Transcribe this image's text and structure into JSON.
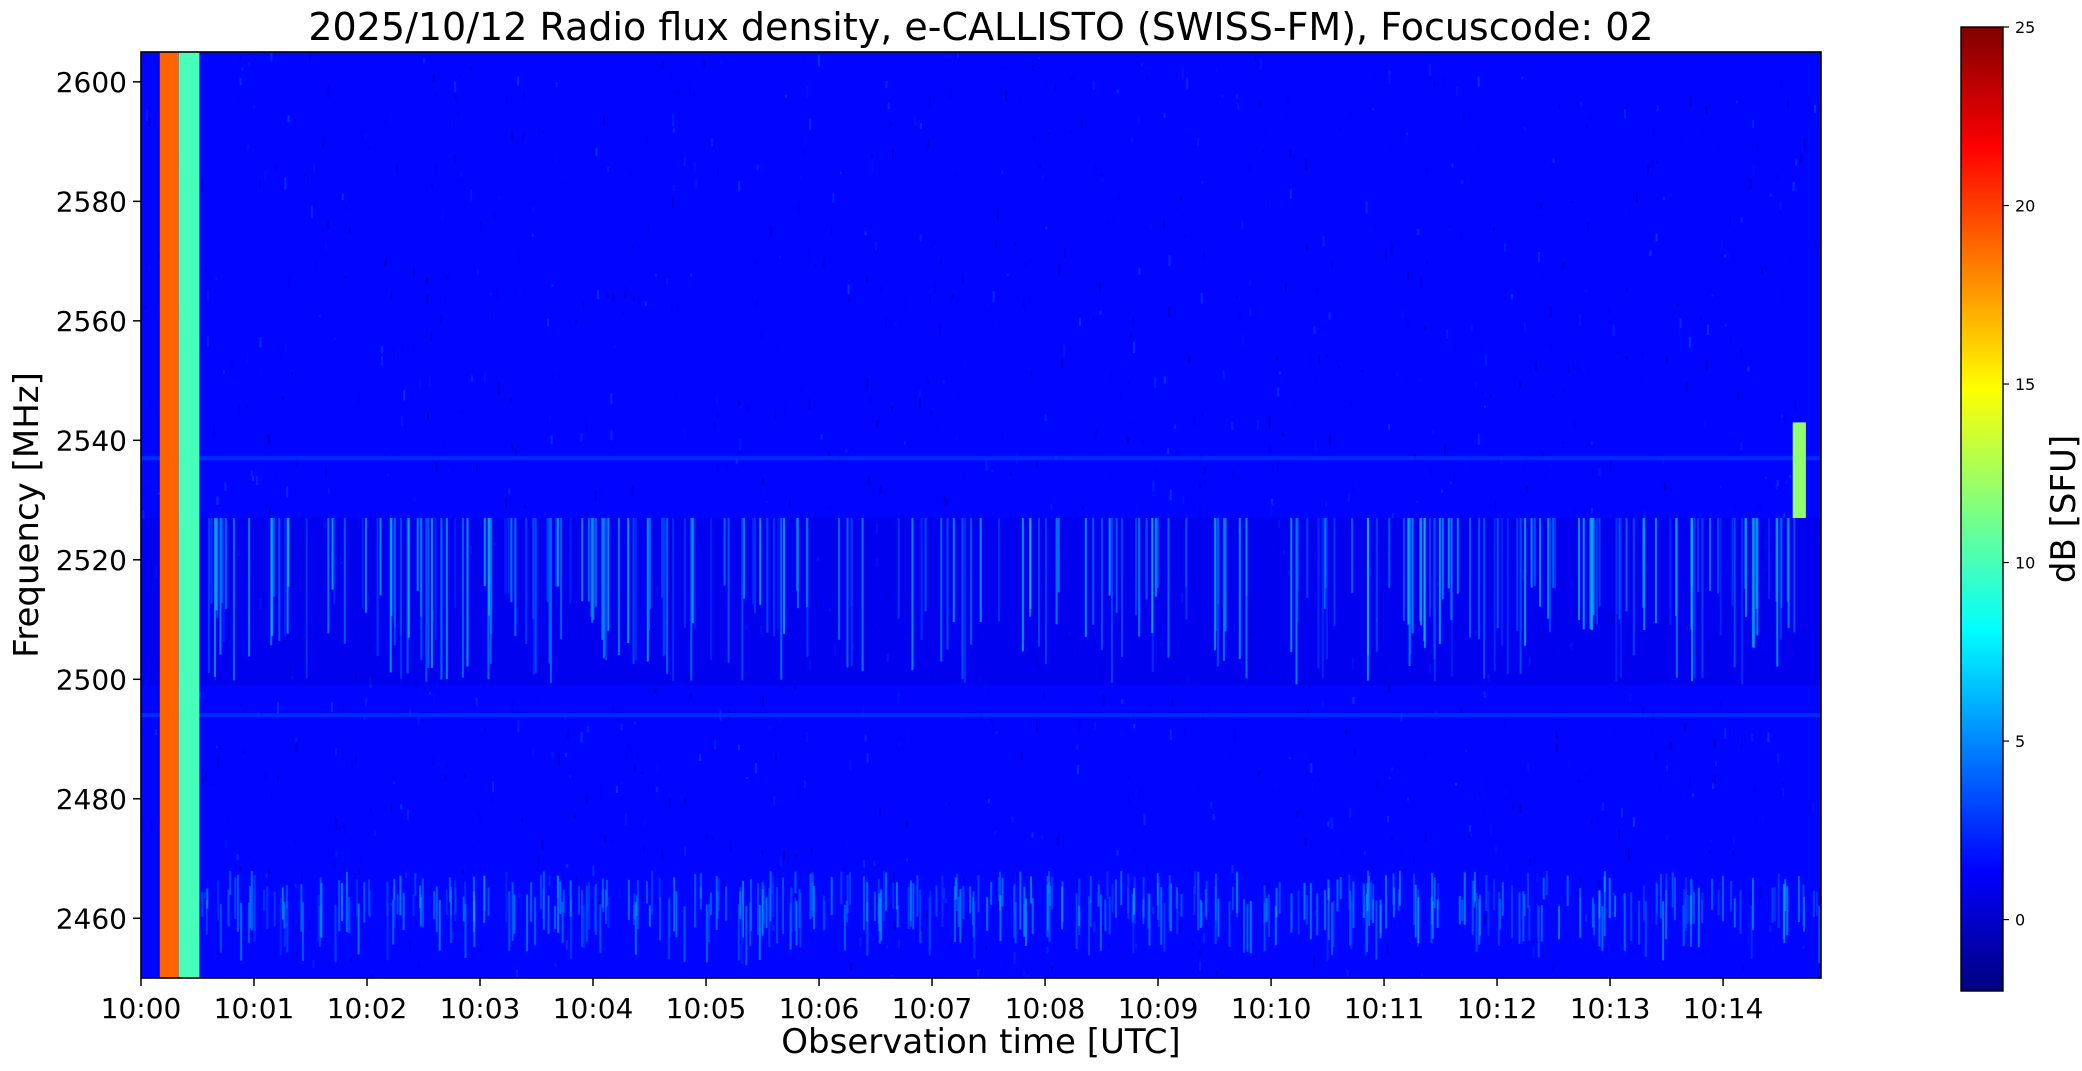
{
  "chart_data": {
    "type": "heatmap",
    "title": "2025/10/12  Radio flux density, e-CALLISTO (SWISS-FM), Focuscode: 02",
    "xlabel": "Observation time [UTC]",
    "ylabel": "Frequency [MHz]",
    "colorbar_label": "dB [SFU]",
    "colormap": "jet",
    "colorbar_stops": [
      "#00007f",
      "#0000ff",
      "#007fff",
      "#00ffff",
      "#7fff7f",
      "#ffff00",
      "#ff7f00",
      "#ff0000",
      "#7f0000"
    ],
    "x_range": [
      "10:00:00",
      "10:14:52"
    ],
    "y_range": [
      2450,
      2605
    ],
    "color_range": [
      -2,
      25
    ],
    "x_ticks": [
      "10:00",
      "10:01",
      "10:02",
      "10:03",
      "10:04",
      "10:05",
      "10:06",
      "10:07",
      "10:08",
      "10:09",
      "10:10",
      "10:11",
      "10:12",
      "10:13",
      "10:14"
    ],
    "y_ticks": [
      2460,
      2480,
      2500,
      2520,
      2540,
      2560,
      2580,
      2600
    ],
    "colorbar_ticks": [
      0,
      5,
      10,
      15,
      20,
      25
    ],
    "background_level_db": 1.5,
    "features": [
      {
        "name": "strong broadband emission",
        "time_start": "10:00:10",
        "time_end": "10:00:20",
        "freq_range": [
          2450,
          2605
        ],
        "level_db": 19
      },
      {
        "name": "broadband emission",
        "time_start": "10:00:20",
        "time_end": "10:00:31",
        "freq_range": [
          2450,
          2605
        ],
        "level_db": 10
      },
      {
        "name": "interference burst",
        "time_start": "10:14:37",
        "time_end": "10:14:44",
        "freq_range": [
          2527,
          2543
        ],
        "level_db": 12
      }
    ],
    "interference_band_mhz": [
      2499,
      2527
    ],
    "horizontal_line_mhz": [
      2537,
      2494
    ]
  }
}
